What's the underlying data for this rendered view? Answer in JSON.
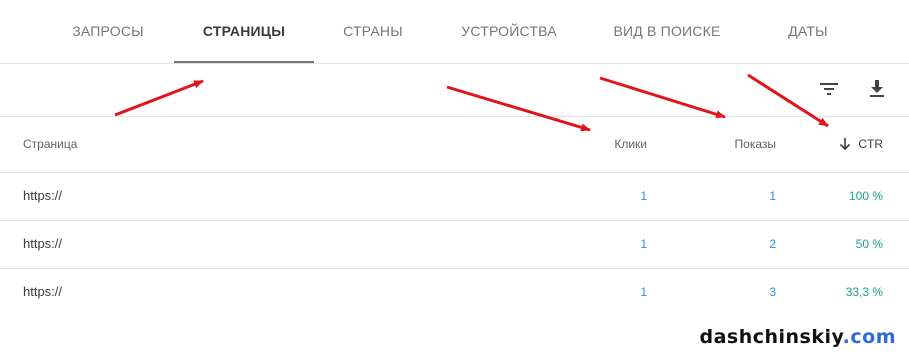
{
  "tabs": [
    {
      "label": "ЗАПРОСЫ",
      "active": false
    },
    {
      "label": "СТРАНИЦЫ",
      "active": true
    },
    {
      "label": "СТРАНЫ",
      "active": false
    },
    {
      "label": "УСТРОЙСТВА",
      "active": false
    },
    {
      "label": "ВИД В ПОИСКЕ",
      "active": false
    },
    {
      "label": "ДАТЫ",
      "active": false
    }
  ],
  "toolbar": {
    "filter_icon": "filter-icon",
    "download_icon": "download-icon"
  },
  "table": {
    "headers": {
      "page": "Страница",
      "clicks": "Клики",
      "impressions": "Показы",
      "ctr": "CTR"
    },
    "sort": {
      "column": "ctr",
      "direction": "descending",
      "icon": "arrow-down-icon"
    },
    "rows": [
      {
        "page": "https://",
        "clicks": "1",
        "impressions": "1",
        "ctr": "100 %"
      },
      {
        "page": "https://",
        "clicks": "1",
        "impressions": "2",
        "ctr": "50 %"
      },
      {
        "page": "https://",
        "clicks": "1",
        "impressions": "3",
        "ctr": "33,3 %"
      }
    ]
  },
  "annotations": {
    "arrow_color": "#e0151b",
    "count": 4
  },
  "watermark": {
    "main": "dashchinskiy",
    "tld": ".com"
  },
  "colors": {
    "link_blue": "#2a8fd7",
    "ctr_teal": "#17a599",
    "watermark_blue": "#2f6ad6"
  }
}
